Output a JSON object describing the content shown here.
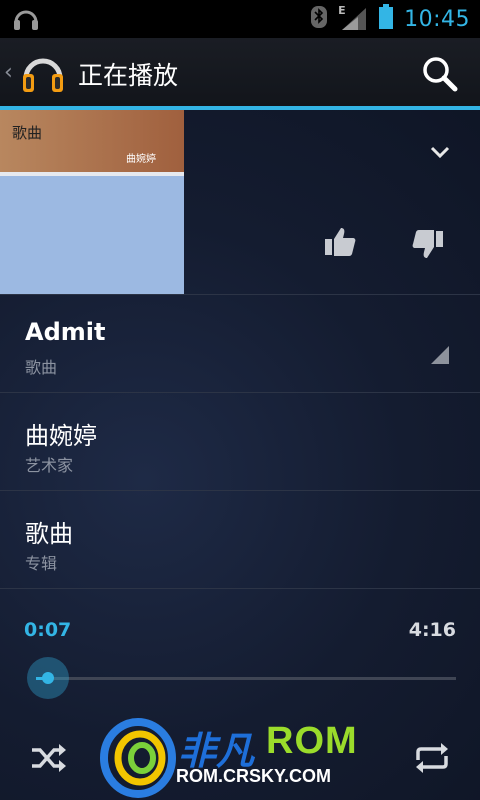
{
  "status_bar": {
    "clock": "10:45",
    "network_type": "E",
    "icons": [
      "headphones-icon",
      "bluetooth-icon",
      "signal-icon",
      "battery-icon"
    ]
  },
  "action_bar": {
    "title": "正在播放",
    "icons": [
      "back-chevron-icon",
      "headphones-app-icon",
      "search-icon"
    ]
  },
  "album": {
    "art_title": "歌曲",
    "art_artist": "曲婉婷"
  },
  "track": {
    "title": "Admit",
    "title_sub": "歌曲",
    "artist": "曲婉婷",
    "artist_label": "艺术家",
    "album": "歌曲",
    "album_label": "专辑"
  },
  "progress": {
    "current": "0:07",
    "total": "4:16",
    "fraction": 0.028
  },
  "controls": {
    "icons": [
      "collapse-chevron-icon",
      "thumbs-up-icon",
      "thumbs-down-icon",
      "shuffle-icon",
      "repeat-icon"
    ]
  },
  "watermark": {
    "brand_cn": "非凡",
    "brand_rom": "ROM",
    "url": "ROM.CRSKY.COM"
  },
  "colors": {
    "accent": "#33b5e5",
    "background": "#141c30",
    "divider": "#2c3446"
  }
}
